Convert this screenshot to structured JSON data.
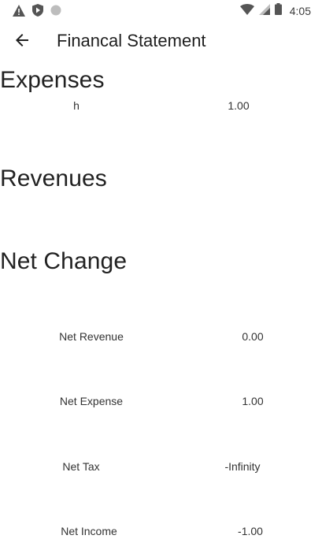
{
  "status_bar": {
    "left_icons": [
      "warning-icon",
      "shield-play-icon",
      "circle-icon"
    ],
    "right_icons": [
      "wifi-icon",
      "signal-icon",
      "battery-icon"
    ],
    "time": "4:05"
  },
  "app_bar": {
    "back_icon": "arrow-left-icon",
    "title": "Financal Statement"
  },
  "expenses": {
    "heading": "Expenses",
    "items": [
      {
        "label": "h",
        "value": "1.00"
      }
    ]
  },
  "revenues": {
    "heading": "Revenues",
    "items": []
  },
  "net_change": {
    "heading": "Net Change",
    "rows": [
      {
        "label": "Net Revenue",
        "value": "0.00"
      },
      {
        "label": "Net Expense",
        "value": "1.00"
      },
      {
        "label": "Net Tax",
        "value": "-Infinity"
      },
      {
        "label": "Net Income",
        "value": "-1.00"
      }
    ]
  }
}
